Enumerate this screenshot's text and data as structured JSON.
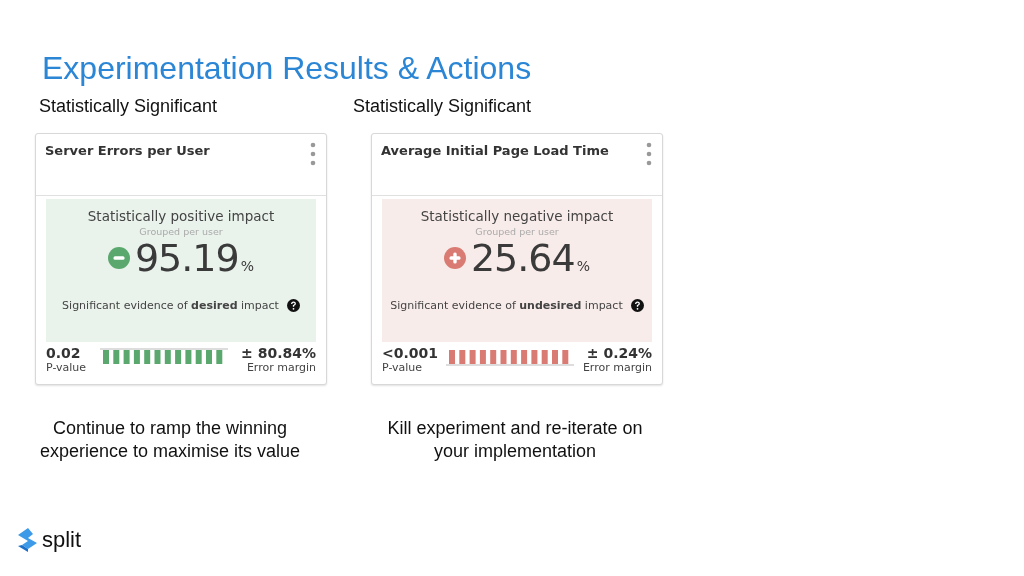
{
  "title": "Experimentation Results & Actions",
  "columns": [
    {
      "heading": "Statistically Significant",
      "card": {
        "title": "Server Errors per User",
        "kind": "positive",
        "verdict": "Statistically positive impact",
        "grouping": "Grouped per user",
        "value": "95.19",
        "unit": "%",
        "evidence": "Significant evidence of **desired** impact",
        "p_value": "0.02",
        "p_value_label": "P-value",
        "error_margin": "± 80.84%",
        "error_margin_label": "Error margin"
      },
      "caption": "Continue to ramp the winning experience to maximise its value"
    },
    {
      "heading": "Statistically Significant",
      "card": {
        "title": "Average Initial Page Load Time",
        "kind": "negative",
        "verdict": "Statistically negative impact",
        "grouping": "Grouped per user",
        "value": "25.64",
        "unit": "%",
        "evidence": "Significant evidence of **undesired** impact",
        "p_value": "<0.001",
        "p_value_label": "P-value",
        "error_margin": "± 0.24%",
        "error_margin_label": "Error margin"
      },
      "caption": "Kill experiment and re-iterate on your implementation"
    }
  ],
  "logo": {
    "text": "split"
  }
}
